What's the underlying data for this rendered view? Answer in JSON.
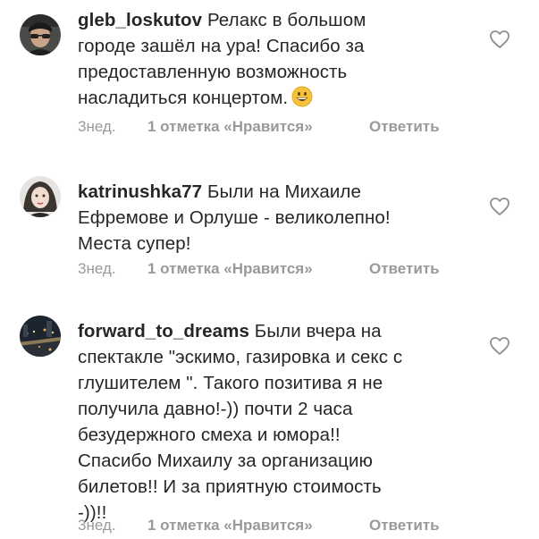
{
  "comments": [
    {
      "username": "gleb_loskutov",
      "lines": [
        "Релакс в большом",
        "городе зашёл на ура! Спасибо за",
        "предоставленную возможность",
        "насладиться концертом."
      ],
      "emoji": "grinning-face-emoji",
      "time": "3нед.",
      "likes": "1 отметка «Нравится»",
      "reply": "Ответить"
    },
    {
      "username": "katrinushka77",
      "lines": [
        "Были на Михаиле",
        "Ефремове и Орлуше - великолепно!",
        "Места супер!"
      ],
      "time": "3нед.",
      "likes": "1 отметка «Нравится»",
      "reply": "Ответить"
    },
    {
      "username": "forward_to_dreams",
      "lines": [
        "Были вчера на",
        "спектакле \"эскимо, газировка и секс с",
        "глушителем \". Такого позитива я не",
        "получила давно!-)) почти 2 часа",
        "безудержного смеха и юмора!!",
        "Спасибо Михаилу за организацию",
        "билетов!! И за приятную стоимость",
        "-))!!"
      ],
      "time": "3нед.",
      "likes": "1 отметка «Нравится»",
      "reply": "Ответить"
    }
  ],
  "colors": {
    "text": "#262626",
    "meta": "#999999",
    "heart": "#8e8e8e"
  },
  "icons": {
    "like": "heart-outline-icon"
  }
}
